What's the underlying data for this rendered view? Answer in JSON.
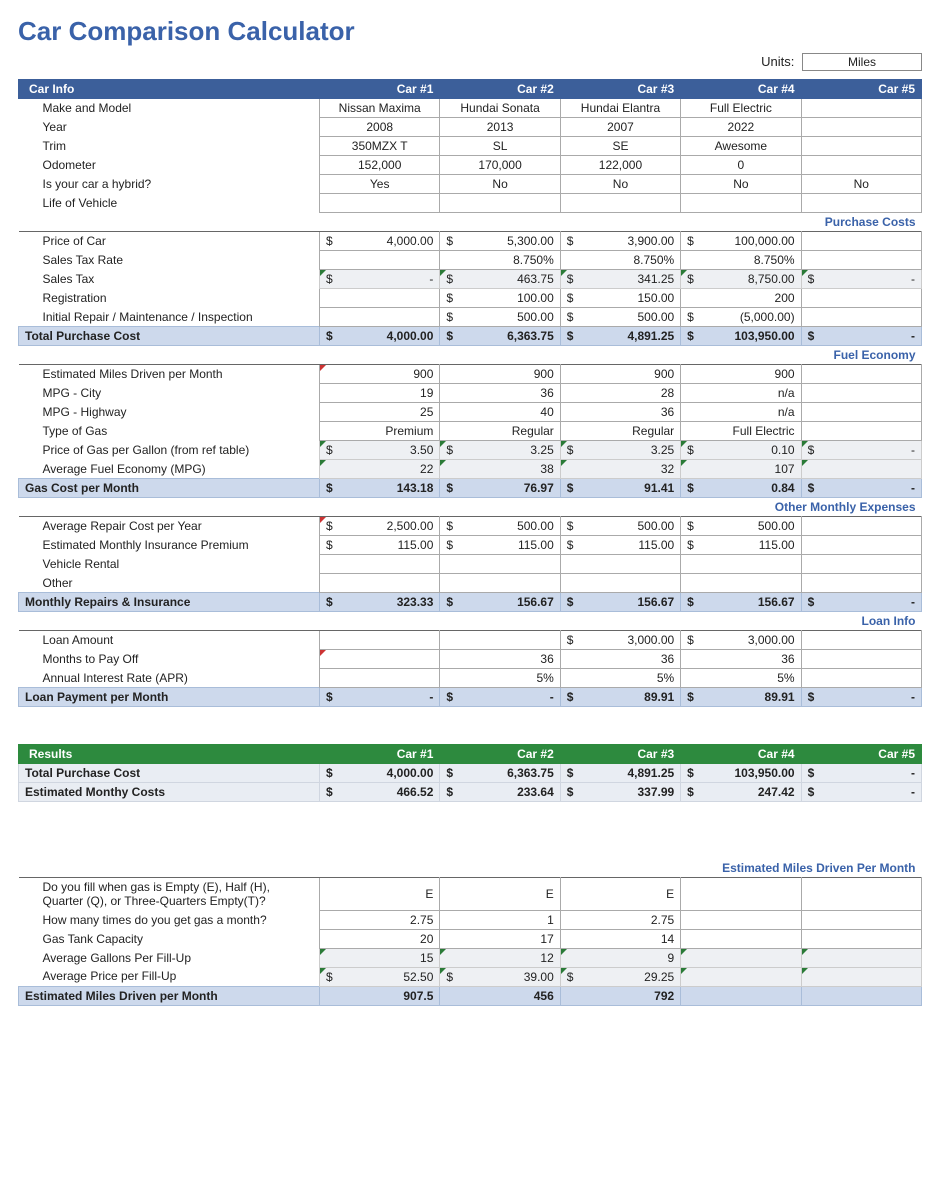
{
  "title": "Car Comparison Calculator",
  "units_label": "Units:",
  "units_value": "Miles",
  "car_headers": [
    "Car #1",
    "Car #2",
    "Car #3",
    "Car #4",
    "Car #5"
  ],
  "sections": {
    "car_info": {
      "header": "Car Info",
      "rows": {
        "make": {
          "label": "Make and Model",
          "v": [
            "Nissan Maxima",
            "Hundai Sonata",
            "Hundai Elantra",
            "Full Electric",
            ""
          ]
        },
        "year": {
          "label": "Year",
          "v": [
            "2008",
            "2013",
            "2007",
            "2022",
            ""
          ]
        },
        "trim": {
          "label": "Trim",
          "v": [
            "350MZX T",
            "SL",
            "SE",
            "Awesome",
            ""
          ]
        },
        "odo": {
          "label": "Odometer",
          "v": [
            "152,000",
            "170,000",
            "122,000",
            "0",
            ""
          ]
        },
        "hyb": {
          "label": "Is your car a hybrid?",
          "v": [
            "Yes",
            "No",
            "No",
            "No",
            "No"
          ]
        },
        "life": {
          "label": "Life of Vehicle",
          "v": [
            "",
            "",
            "",
            "",
            ""
          ]
        }
      }
    },
    "purchase": {
      "title": "Purchase Costs",
      "rows": {
        "price": {
          "label": "Price of Car",
          "v": [
            "4,000.00",
            "5,300.00",
            "3,900.00",
            "100,000.00",
            ""
          ],
          "money": true
        },
        "taxr": {
          "label": "Sales Tax Rate",
          "v": [
            "",
            "8.750%",
            "8.750%",
            "8.750%",
            ""
          ]
        },
        "tax": {
          "label": "Sales Tax",
          "v": [
            "-",
            "463.75",
            "341.25",
            "8,750.00",
            "-"
          ],
          "money": true,
          "calc": true
        },
        "reg": {
          "label": "Registration",
          "v": [
            "",
            "100.00",
            "150.00",
            "200",
            ""
          ],
          "money_some": [
            false,
            true,
            true,
            false,
            false
          ]
        },
        "rep": {
          "label": "Initial Repair / Maintenance / Inspection",
          "v": [
            "",
            "500.00",
            "500.00",
            "(5,000.00)",
            ""
          ],
          "money_some": [
            false,
            true,
            true,
            true,
            false
          ]
        }
      },
      "total": {
        "label": "Total Purchase Cost",
        "v": [
          "4,000.00",
          "6,363.75",
          "4,891.25",
          "103,950.00",
          "-"
        ],
        "money": true
      }
    },
    "fuel": {
      "title": "Fuel Economy",
      "rows": {
        "miles": {
          "label": "Estimated Miles Driven per Month",
          "v": [
            "900",
            "900",
            "900",
            "900",
            ""
          ],
          "red": [
            true,
            false,
            false,
            false,
            false
          ]
        },
        "mpgC": {
          "label": "MPG - City",
          "v": [
            "19",
            "36",
            "28",
            "n/a",
            ""
          ]
        },
        "mpgH": {
          "label": "MPG - Highway",
          "v": [
            "25",
            "40",
            "36",
            "n/a",
            ""
          ]
        },
        "type": {
          "label": "Type of Gas",
          "v": [
            "Premium",
            "Regular",
            "Regular",
            "Full Electric",
            ""
          ]
        },
        "ppg": {
          "label": "Price of Gas per Gallon (from ref table)",
          "v": [
            "3.50",
            "3.25",
            "3.25",
            "0.10",
            "-"
          ],
          "money": true,
          "calc": true
        },
        "avg": {
          "label": "Average Fuel Economy (MPG)",
          "v": [
            "22",
            "38",
            "32",
            "107",
            ""
          ],
          "calc": true
        }
      },
      "total": {
        "label": "Gas Cost per Month",
        "v": [
          "143.18",
          "76.97",
          "91.41",
          "0.84",
          "-"
        ],
        "money": true
      }
    },
    "other": {
      "title": "Other Monthly Expenses",
      "rows": {
        "rep": {
          "label": "Average Repair Cost per Year",
          "v": [
            "2,500.00",
            "500.00",
            "500.00",
            "500.00",
            ""
          ],
          "money": true,
          "red": [
            true,
            false,
            false,
            false,
            false
          ]
        },
        "ins": {
          "label": "Estimated Monthly Insurance Premium",
          "v": [
            "115.00",
            "115.00",
            "115.00",
            "115.00",
            ""
          ],
          "money": true
        },
        "rent": {
          "label": "Vehicle Rental",
          "v": [
            "",
            "",
            "",
            "",
            ""
          ]
        },
        "oth": {
          "label": "Other",
          "v": [
            "",
            "",
            "",
            "",
            ""
          ]
        }
      },
      "total": {
        "label": "Monthly Repairs & Insurance",
        "v": [
          "323.33",
          "156.67",
          "156.67",
          "156.67",
          "-"
        ],
        "money": true
      }
    },
    "loan": {
      "title": "Loan Info",
      "rows": {
        "amt": {
          "label": "Loan Amount",
          "v": [
            "",
            "",
            "3,000.00",
            "3,000.00",
            ""
          ],
          "money_some": [
            false,
            false,
            true,
            true,
            false
          ]
        },
        "mon": {
          "label": "Months to Pay Off",
          "v": [
            "",
            "36",
            "36",
            "36",
            ""
          ],
          "red": [
            true,
            false,
            false,
            false,
            false
          ]
        },
        "apr": {
          "label": "Annual Interest Rate (APR)",
          "v": [
            "",
            "5%",
            "5%",
            "5%",
            ""
          ]
        }
      },
      "total": {
        "label": "Loan Payment per Month",
        "v": [
          "-",
          "-",
          "89.91",
          "89.91",
          "-"
        ],
        "money": true
      }
    },
    "results": {
      "header": "Results",
      "rows": {
        "tpc": {
          "label": "Total Purchase Cost",
          "v": [
            "4,000.00",
            "6,363.75",
            "4,891.25",
            "103,950.00",
            "-"
          ],
          "money": true
        },
        "emc": {
          "label": "Estimated Monthy Costs",
          "v": [
            "466.52",
            "233.64",
            "337.99",
            "247.42",
            "-"
          ],
          "money": true
        }
      }
    },
    "miles": {
      "title": "Estimated Miles Driven Per Month",
      "rows": {
        "fill": {
          "label": "Do you fill when gas is Empty (E), Half (H), Quarter (Q), or Three-Quarters Empty(T)?",
          "v": [
            "E",
            "E",
            "E",
            "",
            ""
          ]
        },
        "times": {
          "label": "How many times do you get gas a month?",
          "v": [
            "2.75",
            "1",
            "2.75",
            "",
            ""
          ]
        },
        "tank": {
          "label": "Gas Tank Capacity",
          "v": [
            "20",
            "17",
            "14",
            "",
            ""
          ]
        },
        "gpf": {
          "label": "Average Gallons Per Fill-Up",
          "v": [
            "15",
            "12",
            "9",
            "",
            ""
          ],
          "calc": true
        },
        "ppf": {
          "label": "Average Price per Fill-Up",
          "v": [
            "52.50",
            "39.00",
            "29.25",
            "",
            ""
          ],
          "money": true,
          "calc": true
        }
      },
      "total": {
        "label": "Estimated Miles Driven per Month",
        "v": [
          "907.5",
          "456",
          "792",
          "",
          ""
        ]
      }
    }
  }
}
